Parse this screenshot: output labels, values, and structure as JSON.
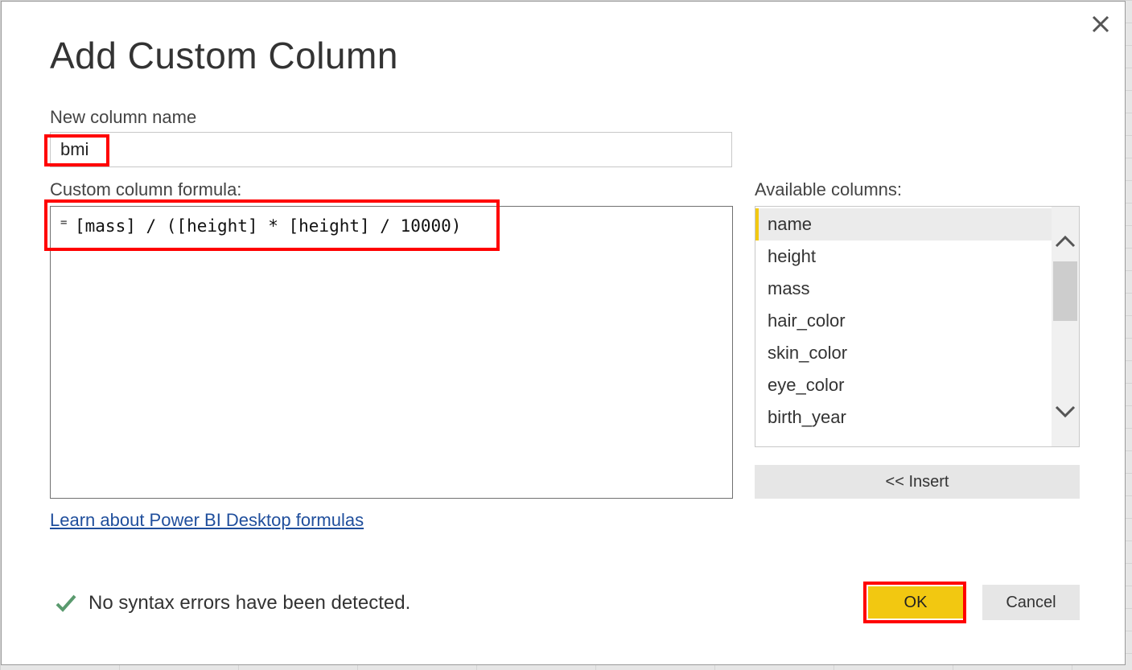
{
  "dialog": {
    "title": "Add Custom Column",
    "close_icon": "close-icon"
  },
  "new_column": {
    "label": "New column name",
    "value": "bmi"
  },
  "formula": {
    "label": "Custom column formula:",
    "prefix": "=",
    "text": "[mass] / ([height] * [height] / 10000)"
  },
  "available_columns": {
    "label": "Available columns:",
    "items": [
      "name",
      "height",
      "mass",
      "hair_color",
      "skin_color",
      "eye_color",
      "birth_year"
    ],
    "selected": "name",
    "scroll_up_icon": "chevron-up-icon",
    "scroll_down_icon": "chevron-down-icon"
  },
  "insert_label": "<< Insert",
  "learn_link": "Learn about Power BI Desktop formulas",
  "status": {
    "icon": "checkmark-icon",
    "text": "No syntax errors have been detected."
  },
  "buttons": {
    "ok": "OK",
    "cancel": "Cancel"
  },
  "colors": {
    "accent": "#f2c811",
    "highlight": "#ff0000",
    "link": "#1f4e9c",
    "success": "#5a9a6e"
  }
}
